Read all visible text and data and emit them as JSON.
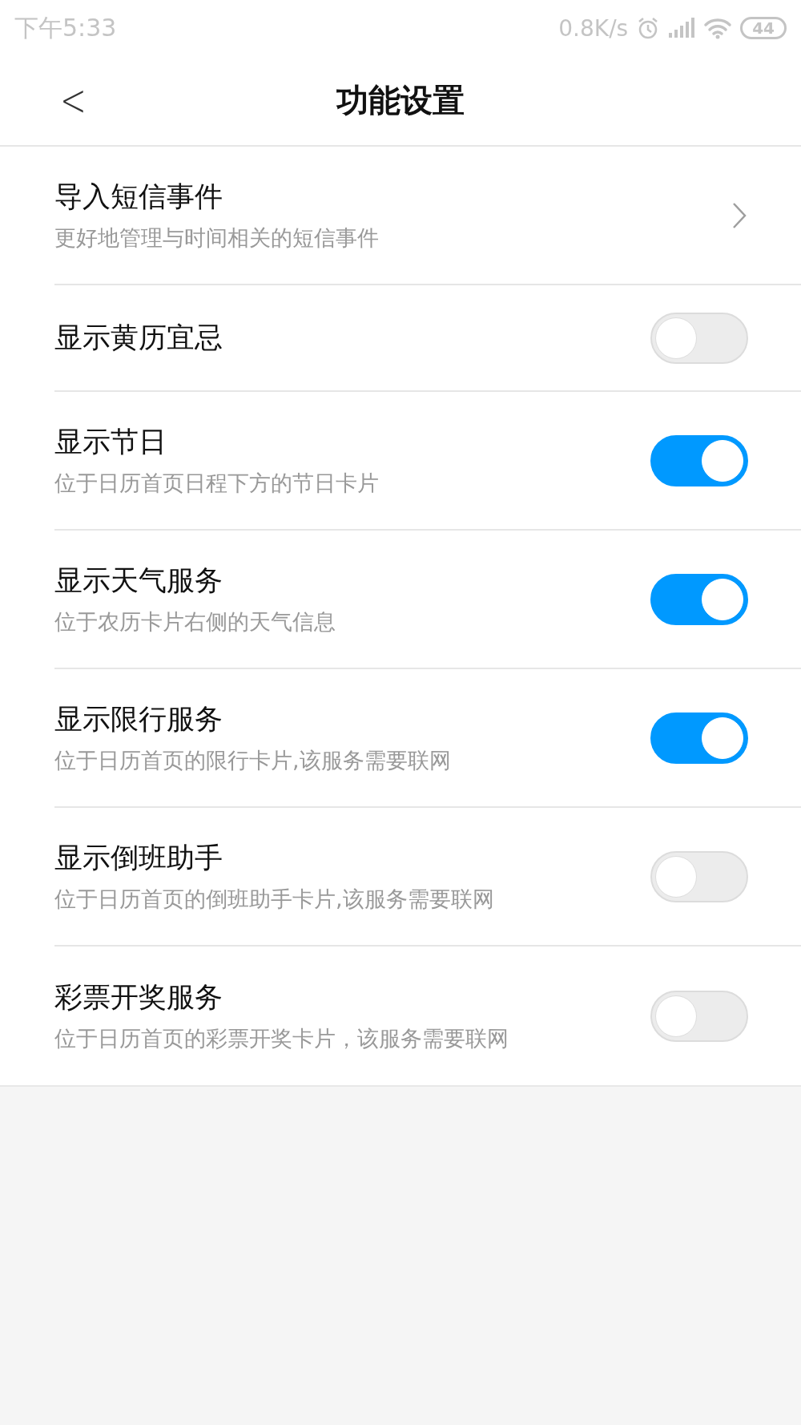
{
  "status_bar": {
    "time": "下午5:33",
    "speed": "0.8K/s",
    "battery": "44"
  },
  "header": {
    "back": "<",
    "title": "功能设置"
  },
  "items": [
    {
      "kind": "link",
      "title": "导入短信事件",
      "subtitle": "更好地管理与时间相关的短信事件"
    },
    {
      "kind": "switch",
      "title": "显示黄历宜忌",
      "on": false
    },
    {
      "kind": "switch",
      "title": "显示节日",
      "subtitle": "位于日历首页日程下方的节日卡片",
      "on": true
    },
    {
      "kind": "switch",
      "title": "显示天气服务",
      "subtitle": "位于农历卡片右侧的天气信息",
      "on": true
    },
    {
      "kind": "switch",
      "title": "显示限行服务",
      "subtitle": "位于日历首页的限行卡片,该服务需要联网",
      "on": true
    },
    {
      "kind": "switch",
      "title": "显示倒班助手",
      "subtitle": "位于日历首页的倒班助手卡片,该服务需要联网",
      "on": false
    },
    {
      "kind": "switch",
      "title": "彩票开奖服务",
      "subtitle": "位于日历首页的彩票开奖卡片，该服务需要联网",
      "on": false
    }
  ]
}
